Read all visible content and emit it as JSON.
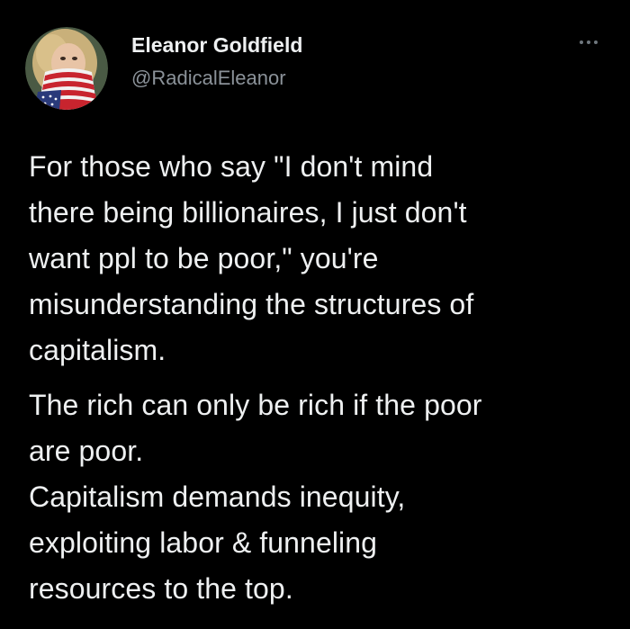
{
  "author": {
    "display_name": "Eleanor Goldfield",
    "handle": "@RadicalEleanor",
    "avatar_icon": "profile-photo-flag-bandana"
  },
  "more_icon": "more-options-icon",
  "tweet": {
    "paragraphs": [
      [
        "For those who say \"I don't mind",
        "there being billionaires, I just don't",
        "want ppl to be poor,\" you're",
        "misunderstanding the structures of",
        "capitalism."
      ],
      [
        "The rich can only be rich if the poor",
        "are poor.",
        "Capitalism demands inequity,",
        "exploiting labor & funneling",
        "resources to the top."
      ]
    ]
  },
  "colors": {
    "background": "#000000",
    "text": "#eef0f1",
    "secondary_text": "#8b9299"
  }
}
